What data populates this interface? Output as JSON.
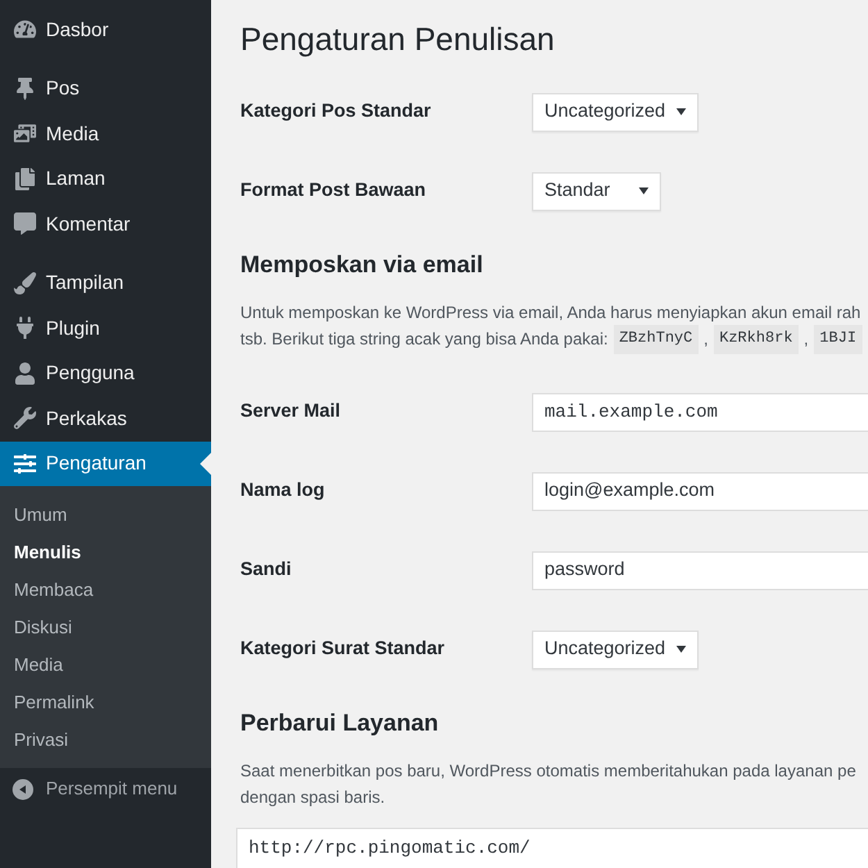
{
  "sidebar": {
    "groups": [
      {
        "items": [
          {
            "label": "Dasbor",
            "selected": false
          }
        ]
      },
      {
        "items": [
          {
            "label": "Pos",
            "selected": false
          },
          {
            "label": "Media",
            "selected": false
          },
          {
            "label": "Laman",
            "selected": false
          },
          {
            "label": "Komentar",
            "selected": false
          }
        ]
      },
      {
        "items": [
          {
            "label": "Tampilan",
            "selected": false
          },
          {
            "label": "Plugin",
            "selected": false
          },
          {
            "label": "Pengguna",
            "selected": false
          },
          {
            "label": "Perkakas",
            "selected": false
          },
          {
            "label": "Pengaturan",
            "selected": true,
            "children": [
              {
                "label": "Umum",
                "selected": false
              },
              {
                "label": "Menulis",
                "selected": true
              },
              {
                "label": "Membaca",
                "selected": false
              },
              {
                "label": "Diskusi",
                "selected": false
              },
              {
                "label": "Media",
                "selected": false
              },
              {
                "label": "Permalink",
                "selected": false
              },
              {
                "label": "Privasi",
                "selected": false
              }
            ]
          }
        ]
      }
    ],
    "collapse_label": "Persempit menu"
  },
  "main": {
    "title": "Pengaturan Penulisan",
    "sections": [
      {
        "fields": [
          {
            "label": "Kategori Pos Standar",
            "kind": "select",
            "value": "Uncategorized"
          },
          {
            "label": "Format Post Bawaan",
            "kind": "select",
            "value": "Standar"
          }
        ]
      },
      {
        "heading": "Memposkan via email",
        "description": [
          [
            {
              "kind": "text",
              "text": "Untuk memposkan ke WordPress via email, Anda harus menyiapkan akun email rah"
            }
          ],
          [
            {
              "kind": "text",
              "text": "tsb. Berikut tiga string acak yang bisa Anda pakai:"
            },
            {
              "kind": "code",
              "text": "ZBzhTnyC"
            },
            {
              "kind": "text",
              "text": ","
            },
            {
              "kind": "code",
              "text": "KzRkh8rk"
            },
            {
              "kind": "text",
              "text": ","
            },
            {
              "kind": "code",
              "text": "1BJI"
            }
          ]
        ],
        "fields": [
          {
            "label": "Server Mail",
            "kind": "code_input",
            "value": "mail.example.com"
          },
          {
            "label": "Nama log",
            "kind": "input",
            "value": "login@example.com"
          },
          {
            "label": "Sandi",
            "kind": "input",
            "value": "password"
          },
          {
            "label": "Kategori Surat Standar",
            "kind": "select",
            "value": "Uncategorized"
          }
        ]
      },
      {
        "heading": "Perbarui Layanan",
        "description": [
          [
            {
              "kind": "text",
              "text": "Saat menerbitkan pos baru, WordPress otomatis memberitahukan pada layanan pe"
            }
          ],
          [
            {
              "kind": "text",
              "text": "dengan spasi baris."
            }
          ]
        ],
        "textarea": {
          "value": "http://rpc.pingomatic.com/"
        }
      }
    ]
  }
}
